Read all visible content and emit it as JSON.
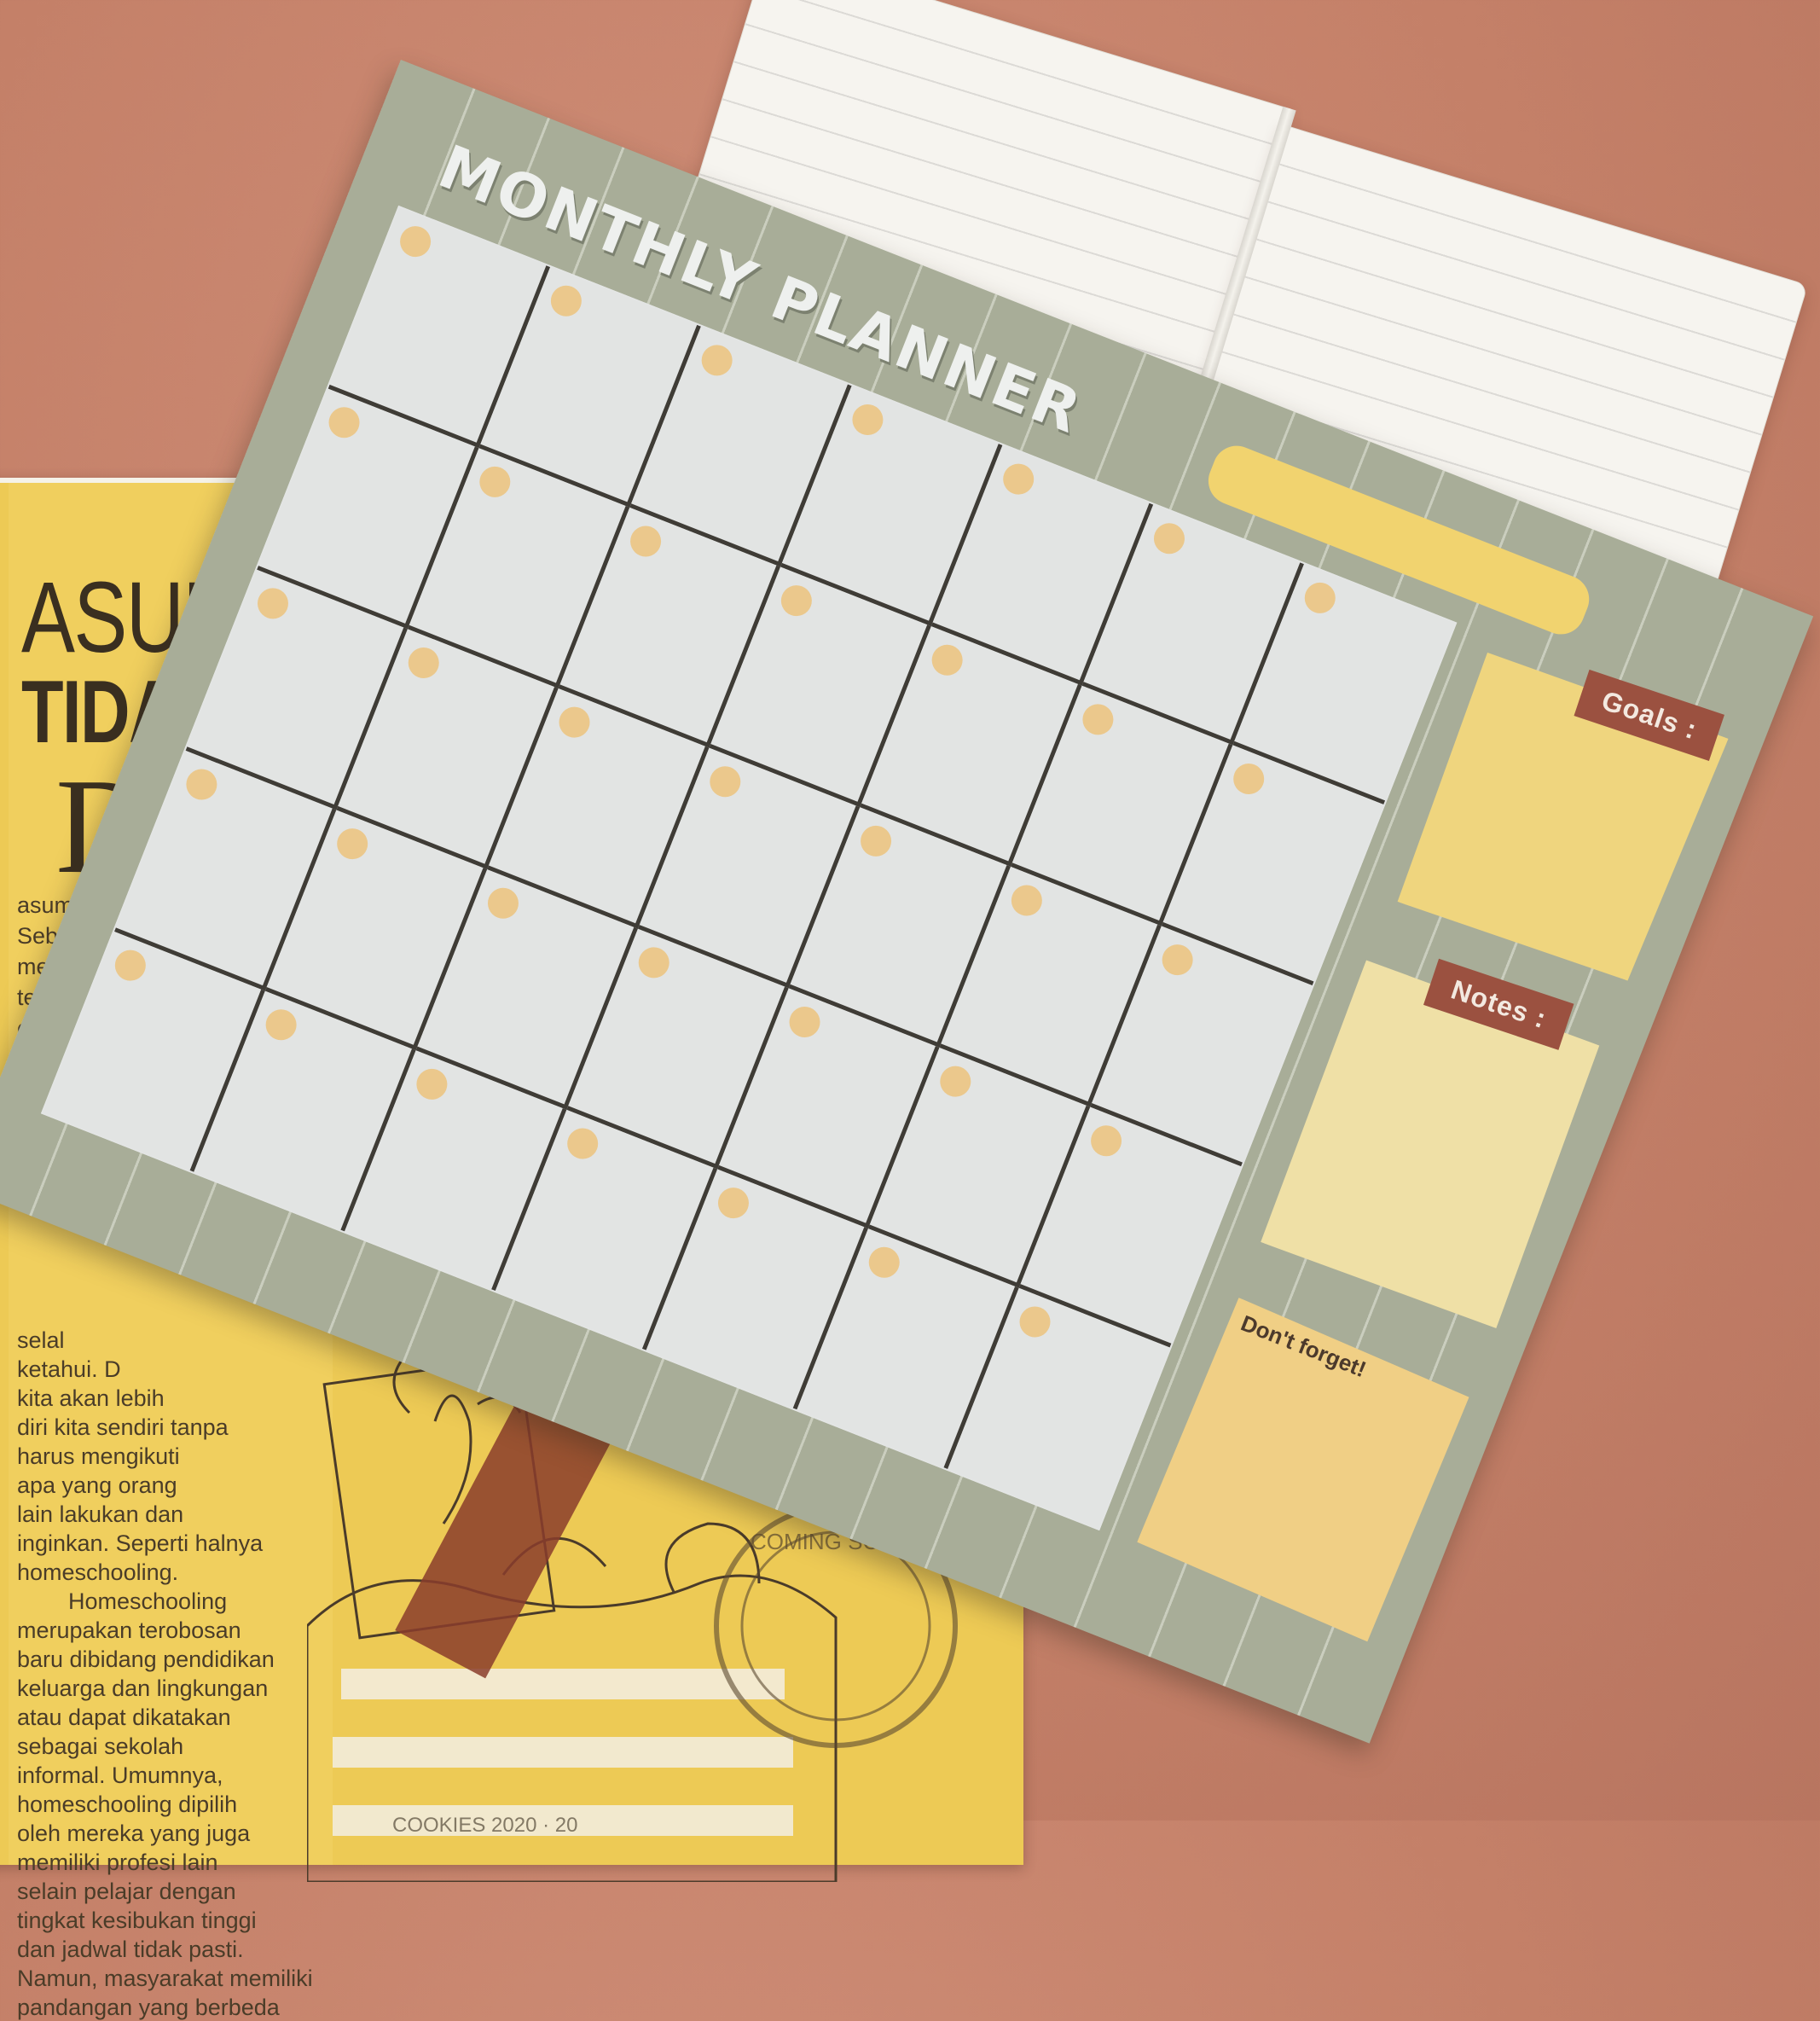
{
  "planner": {
    "title": "MONTHLY PLANNER",
    "goals_label": "Goals :",
    "notes_label": "Notes :",
    "dont_forget_label": "Don't forget!",
    "grid": {
      "rows": 5,
      "columns": 7
    },
    "colors": {
      "sheet": "#a8ad98",
      "cells": "#e2e4e3",
      "grid_lines": "#3f3c36",
      "dots": "#ebc88c",
      "month_bar": "#f1d36f",
      "goals_box": "#efd57e",
      "notes_box": "#efe0a6",
      "forget_box": "#f0cf85",
      "tag": "#9b5140"
    }
  },
  "magazine": {
    "title_line1": "ASUMS",
    "title_line2": "TIDAI",
    "drop_cap": "D",
    "body_lines": [
      "asums",
      "Seba",
      "mer",
      "ter",
      "e",
      "selal",
      "ketahui. D",
      "kita akan lebih",
      "diri kita sendiri tanpa",
      "harus mengikuti",
      "apa yang orang",
      "lain lakukan dan",
      "inginkan. Seperti halnya",
      "homeschooling.",
      "Homeschooling",
      "merupakan terobosan",
      "baru dibidang pendidikan",
      "keluarga dan lingkungan",
      "atau dapat dikatakan",
      "sebagai sekolah",
      "informal. Umumnya,",
      "homeschooling dipilih",
      "oleh mereka yang juga",
      "memiliki profesi lain",
      "selain pelajar dengan",
      "tingkat kesibukan tinggi",
      "dan jadwal tidak pasti.",
      "Namun, masyarakat memiliki",
      "pandangan yang berbeda"
    ],
    "stamp_text": "COMING SOON",
    "footer": "COOKIES 2020 · 20",
    "colors": {
      "cover": "#edca55",
      "ink": "#3a2f20",
      "strap": "#8a3d2c"
    }
  },
  "notebook": {
    "colors": {
      "paper": "#f6f4ef",
      "rule": "#dcdad6"
    }
  },
  "background": {
    "color": "#c48068"
  }
}
